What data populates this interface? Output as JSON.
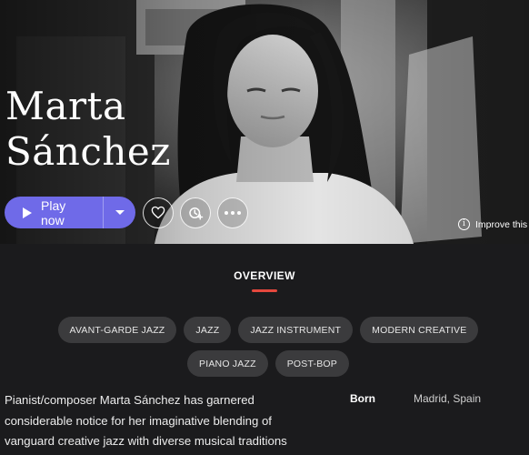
{
  "artist": {
    "name_line1": "Marta",
    "name_line2": "Sánchez"
  },
  "actions": {
    "play_label": "Play now",
    "play_icon": "play-icon",
    "dropdown_icon": "chevron-down-icon",
    "favorite_icon": "heart-icon",
    "queue_icon": "add-to-queue-icon",
    "more_icon": "more-icon"
  },
  "improve": {
    "label": "Improve this",
    "icon": "info-icon"
  },
  "overview": {
    "tab_label": "OVERVIEW"
  },
  "tags": [
    "AVANT-GARDE JAZZ",
    "JAZZ",
    "JAZZ INSTRUMENT",
    "MODERN CREATIVE",
    "PIANO JAZZ",
    "POST-BOP"
  ],
  "bio": {
    "text": "Pianist/composer Marta Sánchez has garnered considerable notice for her imaginative blending of vanguard creative jazz with diverse musical traditions"
  },
  "facts": {
    "born_label": "Born",
    "born_value": "Madrid, Spain"
  },
  "colors": {
    "accent": "#6f6ae8",
    "tab_underline": "#e5483d",
    "background": "#1b1b1d",
    "tag_bg": "#3b3b3d"
  }
}
